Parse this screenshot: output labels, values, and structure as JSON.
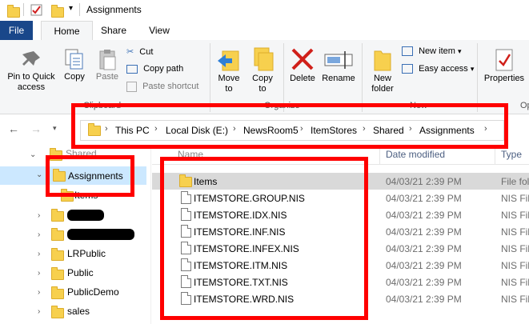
{
  "window": {
    "title": "Assignments"
  },
  "ribbon_tabs": [
    "File",
    "Home",
    "Share",
    "View"
  ],
  "ribbon": {
    "pin_label_1": "Pin to Quick",
    "pin_label_2": "access",
    "copy": "Copy",
    "paste": "Paste",
    "cut": "Cut",
    "copy_path": "Copy path",
    "paste_shortcut": "Paste shortcut",
    "clipboard_group": "Clipboard",
    "move_to": "Move",
    "move_to_2": "to",
    "copy_to": "Copy",
    "copy_to_2": "to",
    "delete": "Delete",
    "rename": "Rename",
    "organize_group": "Organize",
    "new_folder_1": "New",
    "new_folder_2": "folder",
    "new_item": "New item",
    "easy_access": "Easy access",
    "new_group": "New",
    "properties": "Properties",
    "open_group": "Op"
  },
  "address": {
    "crumbs": [
      "This PC",
      "Local Disk (E:)",
      "NewsRoom5",
      "ItemStores",
      "Shared",
      "Assignments"
    ]
  },
  "tree": {
    "top_item": "Shared",
    "selected": "Assignments",
    "child": "Items",
    "items": [
      "LRPublic",
      "Public",
      "PublicDemo",
      "sales"
    ]
  },
  "columns": {
    "name": "Name",
    "date": "Date modified",
    "type": "Type"
  },
  "files": [
    {
      "name": "Items",
      "date": "04/03/21 2:39 PM",
      "type": "File fol",
      "kind": "folder"
    },
    {
      "name": "ITEMSTORE.GROUP.NIS",
      "date": "04/03/21 2:39 PM",
      "type": "NIS File",
      "kind": "file"
    },
    {
      "name": "ITEMSTORE.IDX.NIS",
      "date": "04/03/21 2:39 PM",
      "type": "NIS File",
      "kind": "file"
    },
    {
      "name": "ITEMSTORE.INF.NIS",
      "date": "04/03/21 2:39 PM",
      "type": "NIS File",
      "kind": "file"
    },
    {
      "name": "ITEMSTORE.INFEX.NIS",
      "date": "04/03/21 2:39 PM",
      "type": "NIS File",
      "kind": "file"
    },
    {
      "name": "ITEMSTORE.ITM.NIS",
      "date": "04/03/21 2:39 PM",
      "type": "NIS File",
      "kind": "file"
    },
    {
      "name": "ITEMSTORE.TXT.NIS",
      "date": "04/03/21 2:39 PM",
      "type": "NIS File",
      "kind": "file"
    },
    {
      "name": "ITEMSTORE.WRD.NIS",
      "date": "04/03/21 2:39 PM",
      "type": "NIS File",
      "kind": "file"
    }
  ],
  "colors": {
    "file_tab": "#19478a",
    "selection": "#cce8ff",
    "annotation": "#ff0000",
    "folder": "#f7d04e"
  }
}
